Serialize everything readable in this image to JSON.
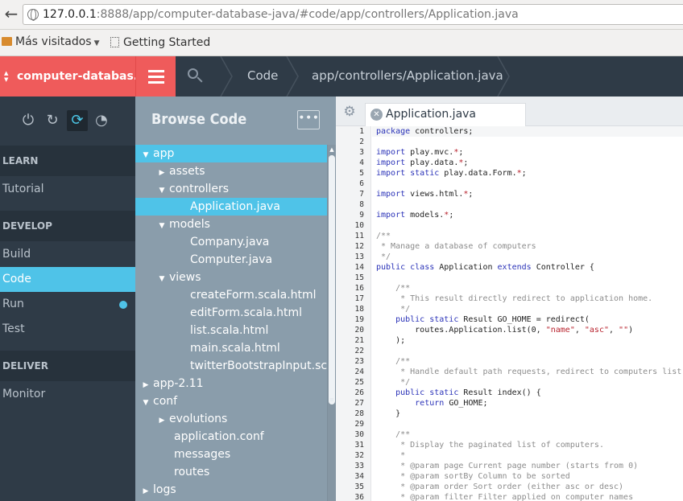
{
  "browser": {
    "url_host": "127.0.0.1",
    "url_rest": ":8888/app/computer-database-java/#code/app/controllers/Application.java",
    "bookmarks": [
      {
        "label": "Más visitados",
        "type": "folder"
      },
      {
        "label": "Getting Started",
        "type": "page"
      }
    ]
  },
  "topbar": {
    "project": "computer-databas...",
    "breadcrumbs": [
      "Code",
      "app/controllers/Application.java"
    ]
  },
  "sidebar": {
    "mode_icons": [
      "power-icon",
      "refresh-icon",
      "code-icon",
      "monitor-icon"
    ],
    "sections": [
      {
        "title": "LEARN",
        "items": [
          "Tutorial"
        ]
      },
      {
        "title": "DEVELOP",
        "items": [
          "Build",
          "Code",
          "Run",
          "Test"
        ]
      },
      {
        "title": "DELIVER",
        "items": [
          "Monitor"
        ]
      }
    ],
    "active_item": "Code"
  },
  "browse": {
    "title": "Browse Code",
    "more_label": "∙∙∙",
    "tree": [
      {
        "label": "app",
        "depth": 0,
        "caret": "open",
        "selected_parent": true
      },
      {
        "label": "assets",
        "depth": 1,
        "caret": "closed"
      },
      {
        "label": "controllers",
        "depth": 1,
        "caret": "open"
      },
      {
        "label": "Application.java",
        "depth": 2,
        "caret": "none",
        "selected": true
      },
      {
        "label": "models",
        "depth": 1,
        "caret": "open"
      },
      {
        "label": "Company.java",
        "depth": 2,
        "caret": "none"
      },
      {
        "label": "Computer.java",
        "depth": 2,
        "caret": "none"
      },
      {
        "label": "views",
        "depth": 1,
        "caret": "open"
      },
      {
        "label": "createForm.scala.html",
        "depth": 2,
        "caret": "none"
      },
      {
        "label": "editForm.scala.html",
        "depth": 2,
        "caret": "none"
      },
      {
        "label": "list.scala.html",
        "depth": 2,
        "caret": "none"
      },
      {
        "label": "main.scala.html",
        "depth": 2,
        "caret": "none"
      },
      {
        "label": "twitterBootstrapInput.scala.",
        "depth": 2,
        "caret": "none"
      },
      {
        "label": "app-2.11",
        "depth": 0,
        "caret": "closed"
      },
      {
        "label": "conf",
        "depth": 0,
        "caret": "open"
      },
      {
        "label": "evolutions",
        "depth": 1,
        "caret": "closed"
      },
      {
        "label": "application.conf",
        "depth": 1,
        "caret": "none"
      },
      {
        "label": "messages",
        "depth": 1,
        "caret": "none"
      },
      {
        "label": "routes",
        "depth": 1,
        "caret": "none"
      },
      {
        "label": "logs",
        "depth": 0,
        "caret": "closed"
      }
    ]
  },
  "editor": {
    "tab_label": "Application.java",
    "lines": [
      [
        {
          "t": "package",
          "c": "kw"
        },
        {
          "t": " controllers;",
          "c": "p"
        }
      ],
      [],
      [
        {
          "t": "import",
          "c": "kw"
        },
        {
          "t": " play.mvc.",
          "c": "p"
        },
        {
          "t": "*",
          "c": "st"
        },
        {
          "t": ";",
          "c": "p"
        }
      ],
      [
        {
          "t": "import",
          "c": "kw"
        },
        {
          "t": " play.data.",
          "c": "p"
        },
        {
          "t": "*",
          "c": "st"
        },
        {
          "t": ";",
          "c": "p"
        }
      ],
      [
        {
          "t": "import static",
          "c": "kw"
        },
        {
          "t": " play.data.Form.",
          "c": "p"
        },
        {
          "t": "*",
          "c": "st"
        },
        {
          "t": ";",
          "c": "p"
        }
      ],
      [],
      [
        {
          "t": "import",
          "c": "kw"
        },
        {
          "t": " views.html.",
          "c": "p"
        },
        {
          "t": "*",
          "c": "st"
        },
        {
          "t": ";",
          "c": "p"
        }
      ],
      [],
      [
        {
          "t": "import",
          "c": "kw"
        },
        {
          "t": " models.",
          "c": "p"
        },
        {
          "t": "*",
          "c": "st"
        },
        {
          "t": ";",
          "c": "p"
        }
      ],
      [],
      [
        {
          "t": "/**",
          "c": "cm"
        }
      ],
      [
        {
          "t": " * Manage a database of computers",
          "c": "cm"
        }
      ],
      [
        {
          "t": " */",
          "c": "cm"
        }
      ],
      [
        {
          "t": "public class",
          "c": "kw"
        },
        {
          "t": " Application ",
          "c": "p"
        },
        {
          "t": "extends",
          "c": "kw"
        },
        {
          "t": " Controller {",
          "c": "p"
        }
      ],
      [],
      [
        {
          "t": "    /**",
          "c": "cm"
        }
      ],
      [
        {
          "t": "     * This result directly redirect to application home.",
          "c": "cm"
        }
      ],
      [
        {
          "t": "     */",
          "c": "cm"
        }
      ],
      [
        {
          "t": "    public static",
          "c": "kw"
        },
        {
          "t": " Result GO_HOME = redirect(",
          "c": "p"
        }
      ],
      [
        {
          "t": "        routes.Application.list(0, ",
          "c": "p"
        },
        {
          "t": "\"name\"",
          "c": "st"
        },
        {
          "t": ", ",
          "c": "p"
        },
        {
          "t": "\"asc\"",
          "c": "st"
        },
        {
          "t": ", ",
          "c": "p"
        },
        {
          "t": "\"\"",
          "c": "st"
        },
        {
          "t": ")",
          "c": "p"
        }
      ],
      [
        {
          "t": "    );",
          "c": "p"
        }
      ],
      [],
      [
        {
          "t": "    /**",
          "c": "cm"
        }
      ],
      [
        {
          "t": "     * Handle default path requests, redirect to computers list",
          "c": "cm"
        }
      ],
      [
        {
          "t": "     */",
          "c": "cm"
        }
      ],
      [
        {
          "t": "    public static",
          "c": "kw"
        },
        {
          "t": " Result index() {",
          "c": "p"
        }
      ],
      [
        {
          "t": "        return",
          "c": "kw"
        },
        {
          "t": " GO_HOME;",
          "c": "p"
        }
      ],
      [
        {
          "t": "    }",
          "c": "p"
        }
      ],
      [],
      [
        {
          "t": "    /**",
          "c": "cm"
        }
      ],
      [
        {
          "t": "     * Display the paginated list of computers.",
          "c": "cm"
        }
      ],
      [
        {
          "t": "     *",
          "c": "cm"
        }
      ],
      [
        {
          "t": "     * @param page Current page number (starts from 0)",
          "c": "cm"
        }
      ],
      [
        {
          "t": "     * @param sortBy Column to be sorted",
          "c": "cm"
        }
      ],
      [
        {
          "t": "     * @param order Sort order (either asc or desc)",
          "c": "cm"
        }
      ],
      [
        {
          "t": "     * @param filter Filter applied on computer names",
          "c": "cm"
        }
      ]
    ]
  },
  "colors": {
    "accent_red": "#ef5b5b",
    "accent_blue": "#4fc3e8",
    "sidebar_bg": "#2f3b47",
    "browse_bg": "#8a9dab",
    "code_keyword": "#2a32b8",
    "code_string": "#b8232e",
    "code_comment": "#8c8c8c"
  }
}
